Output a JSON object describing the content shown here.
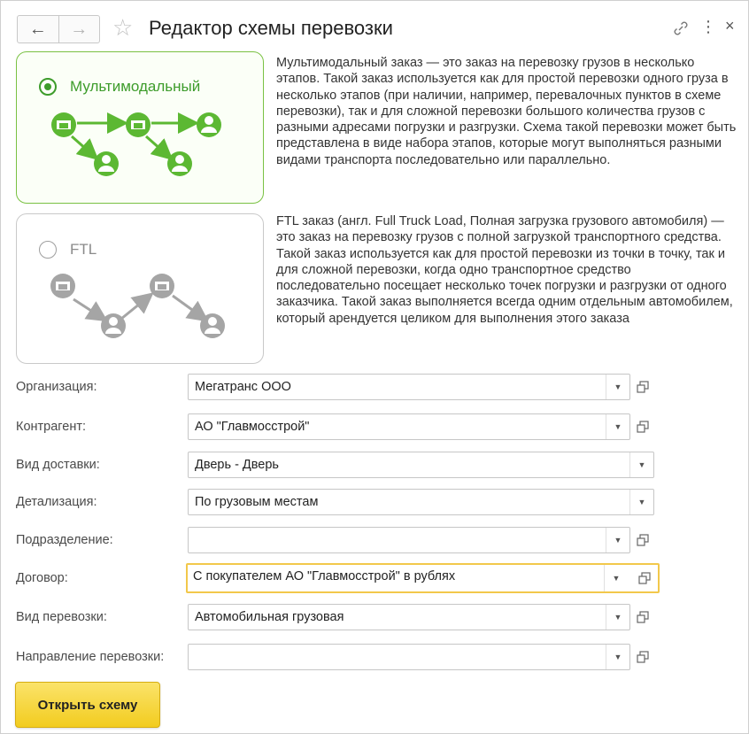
{
  "window": {
    "title": "Редактор схемы перевозки",
    "icons": {
      "back": "arrow-left-icon",
      "forward": "arrow-right-icon",
      "favorite": "star-icon",
      "link": "link-icon",
      "more": "more-vertical-icon",
      "close": "close-icon"
    }
  },
  "options": [
    {
      "label": "Мультимодальный",
      "selected": true,
      "accent": "#3d9c2b",
      "description": "Мультимодальный заказ — это заказ на перевозку грузов в несколько этапов. Такой заказ используется как для простой перевозки одного груза в несколько этапов (при наличии, например, перевалочных пунктов в схеме перевозки), так и для сложной перевозки большого количества грузов с разными адресами погрузки и разгрузки. Схема такой перевозки может быть представлена в виде набора этапов, которые могут выполняться разными видами транспорта последовательно или параллельно."
    },
    {
      "label": "FTL",
      "selected": false,
      "accent": "#9e9e9e",
      "description": "FTL заказ (англ. Full Truck Load, Полная загрузка грузового автомобиля) — это заказ на перевозку грузов с полной загрузкой транспортного средства. Такой заказ используется как для простой перевозки из точки в точку, так и для сложной перевозки, когда одно транспортное средство последовательно посещает несколько точек погрузки и разгрузки от одного заказчика. Такой заказ выполняется всегда одним отдельным автомобилем, который арендуется целиком для выполнения этого заказа"
    }
  ],
  "form": {
    "fields": [
      {
        "label": "Организация:",
        "value": "Мегатранс ООО",
        "has_open": true,
        "focused": false
      },
      {
        "label": "Контрагент:",
        "value": "АО \"Главмосстрой\"",
        "has_open": true,
        "focused": false
      },
      {
        "label": "Вид доставки:",
        "value": "Дверь - Дверь",
        "has_open": false,
        "focused": false
      },
      {
        "label": "Детализация:",
        "value": "По грузовым местам",
        "has_open": false,
        "focused": false
      },
      {
        "label": "Подразделение:",
        "value": "",
        "has_open": true,
        "focused": false
      },
      {
        "label": "Договор:",
        "value": "С покупателем АО \"Главмосстрой\" в рублях",
        "has_open": true,
        "focused": true
      },
      {
        "label": "Вид перевозки:",
        "value": "Автомобильная грузовая",
        "has_open": true,
        "focused": false
      },
      {
        "label": "Направление перевозки:",
        "value": "",
        "has_open": true,
        "focused": false
      }
    ]
  },
  "actions": {
    "open_scheme": "Открыть схему"
  },
  "colors": {
    "focus_border": "#f2c84b",
    "primary_button": "#f5d22f",
    "selected_card_border": "#7ac143"
  }
}
